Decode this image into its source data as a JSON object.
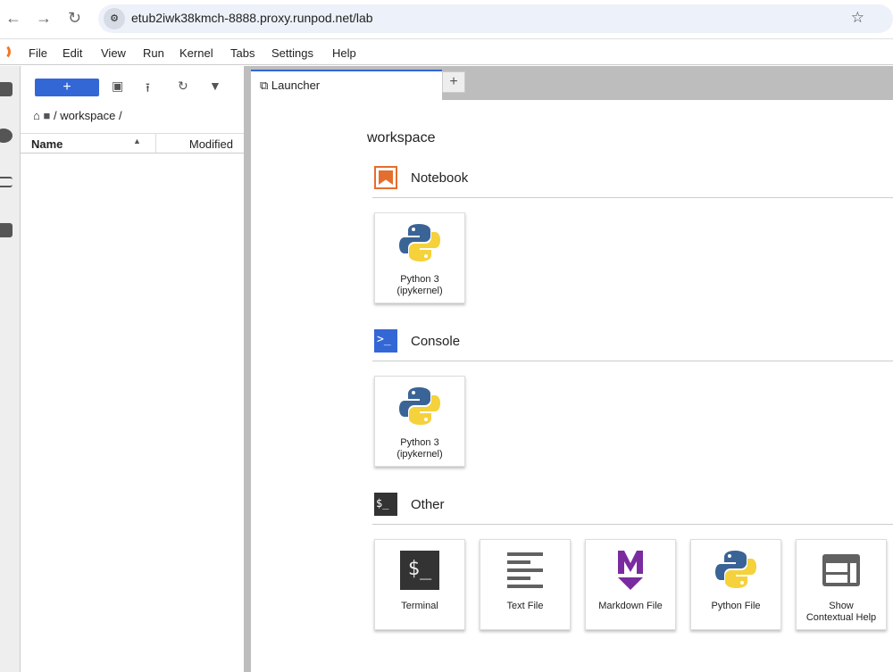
{
  "browser": {
    "url": "etub2iwk38kmch-8888.proxy.runpod.net/lab"
  },
  "menu": [
    "File",
    "Edit",
    "View",
    "Run",
    "Kernel",
    "Tabs",
    "Settings",
    "Help"
  ],
  "filebrowser": {
    "new_label": "+",
    "breadcrumb": "/ workspace /",
    "col_name": "Name",
    "col_modified": "Modified"
  },
  "tab": {
    "label": "Launcher",
    "add": "+"
  },
  "launcher": {
    "cwd": "workspace",
    "sections": {
      "notebook": "Notebook",
      "console": "Console",
      "other": "Other"
    },
    "notebook_card": [
      "Python 3",
      "(ipykernel)"
    ],
    "console_card": [
      "Python 3",
      "(ipykernel)"
    ],
    "other_cards": [
      "Terminal",
      "Text File",
      "Markdown File",
      "Python File",
      "Show",
      "Contextual Help"
    ]
  },
  "colors": {
    "accent": "#3367d6",
    "notebook": "#e46e2e",
    "markdown": "#7b2ba0",
    "python_blue": "#3a6496",
    "python_yellow": "#f5d13c"
  }
}
